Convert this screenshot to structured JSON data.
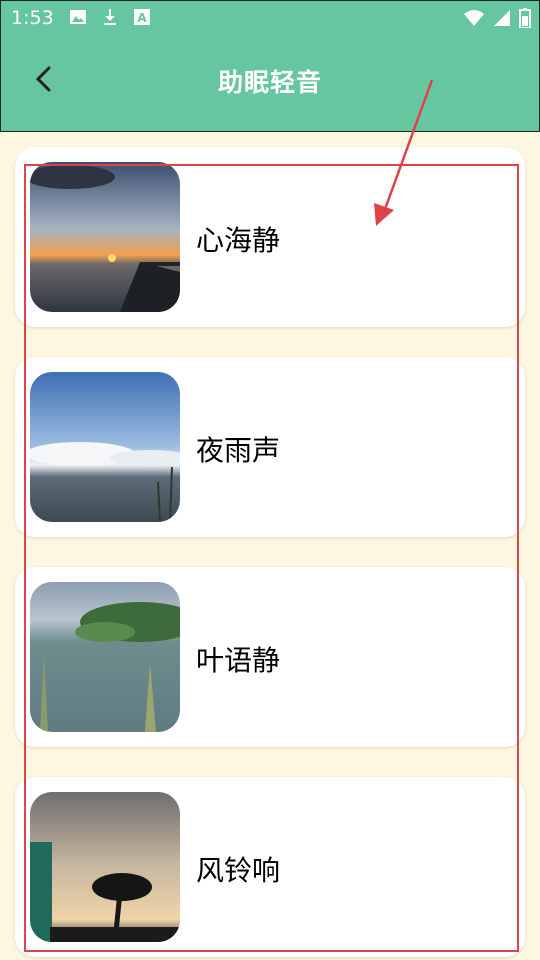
{
  "status_bar": {
    "time": "1:53",
    "icons": [
      "image-icon",
      "download-icon",
      "a-icon"
    ],
    "right_icons": [
      "wifi-icon",
      "signal-icon",
      "battery-icon"
    ]
  },
  "header": {
    "title": "助眠轻音",
    "background": "#66c69f"
  },
  "items": [
    {
      "label": "心海静",
      "image": "sunset-pier-image"
    },
    {
      "label": "夜雨声",
      "image": "lake-clouds-image"
    },
    {
      "label": "叶语静",
      "image": "lake-trees-image"
    },
    {
      "label": "风铃响",
      "image": "palm-sky-image"
    }
  ],
  "annotation_color": "#e0424a"
}
